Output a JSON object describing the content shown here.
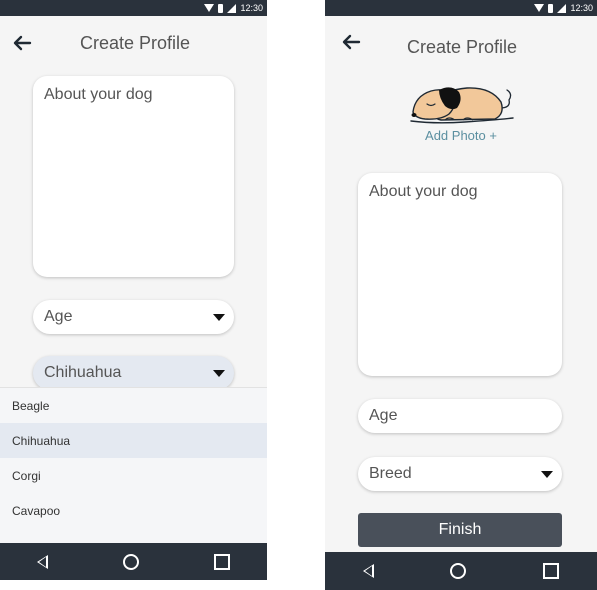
{
  "status_bar": {
    "time": "12:30"
  },
  "left_screen": {
    "title": "Create Profile",
    "about_placeholder": "About your dog",
    "age_field": {
      "value": "Age"
    },
    "breed_field": {
      "value": "Chihuahua"
    },
    "breed_options": [
      {
        "label": "Beagle",
        "selected": false
      },
      {
        "label": "Chihuahua",
        "selected": true
      },
      {
        "label": "Corgi",
        "selected": false
      },
      {
        "label": "Cavapoo",
        "selected": false
      }
    ]
  },
  "right_screen": {
    "title": "Create Profile",
    "add_photo_label": "Add Photo +",
    "about_placeholder": "About your dog",
    "age_field": {
      "value": "Age"
    },
    "breed_field": {
      "value": "Breed"
    },
    "finish_label": "Finish"
  },
  "icons": {
    "back": "arrow-left-icon",
    "dropdown": "caret-down-icon",
    "nav_back": "triangle-left-icon",
    "nav_home": "circle-icon",
    "nav_recents": "square-icon",
    "photo": "sleeping-dog-illustration"
  },
  "colors": {
    "system_bars": "#2a323c",
    "screen_bg": "#f5f5f5",
    "selected_bg": "#e4e9f1",
    "finish_button": "#49505a",
    "link_text": "#5b8fa0"
  }
}
